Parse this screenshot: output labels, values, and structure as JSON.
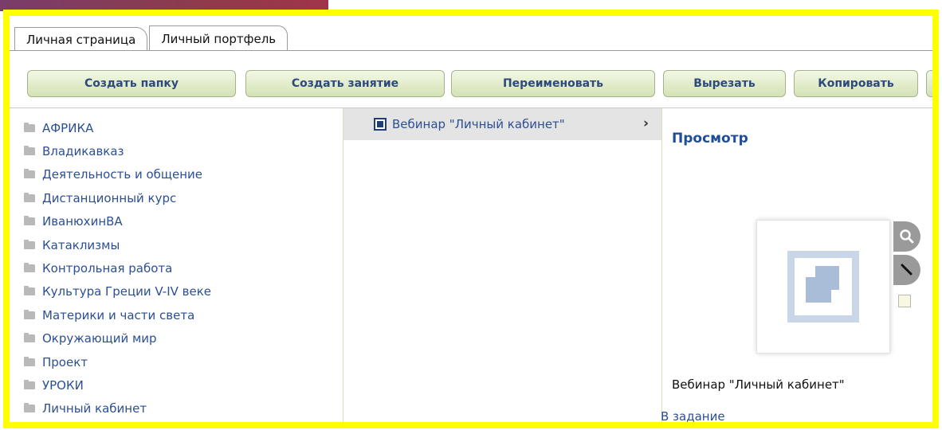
{
  "tabs": [
    {
      "label": "Личная страница"
    },
    {
      "label": "Личный портфель"
    }
  ],
  "toolbar": {
    "create_folder": "Создать папку",
    "create_lesson": "Создать занятие",
    "rename": "Переименовать",
    "cut": "Вырезать",
    "copy": "Копировать"
  },
  "folders": [
    "АФРИКА",
    "Владикавказ",
    "Деятельность и общение",
    "Дистанционный курс",
    "ИванюхинВА",
    "Катаклизмы",
    "Контрольная работа",
    "Культура Греции V-IV веке",
    "Материки и части света",
    "Окружающий мир",
    "Проект",
    "УРОКИ",
    "Личный кабинет"
  ],
  "middle": {
    "item_label": "Вебинар \"Личный кабинет\"",
    "chevron": "›"
  },
  "preview": {
    "title": "Просмотр",
    "caption": "Вебинар \"Личный кабинет\"",
    "assign_link": "В задание"
  },
  "colors": {
    "highlight_frame": "#ffff00",
    "link": "#2c4f93",
    "button_text": "#2d4a7a"
  },
  "icons": {
    "folder": "folder-icon",
    "webinar": "webinar-icon",
    "zoom": "magnifier-icon",
    "edit": "pencil-icon"
  }
}
